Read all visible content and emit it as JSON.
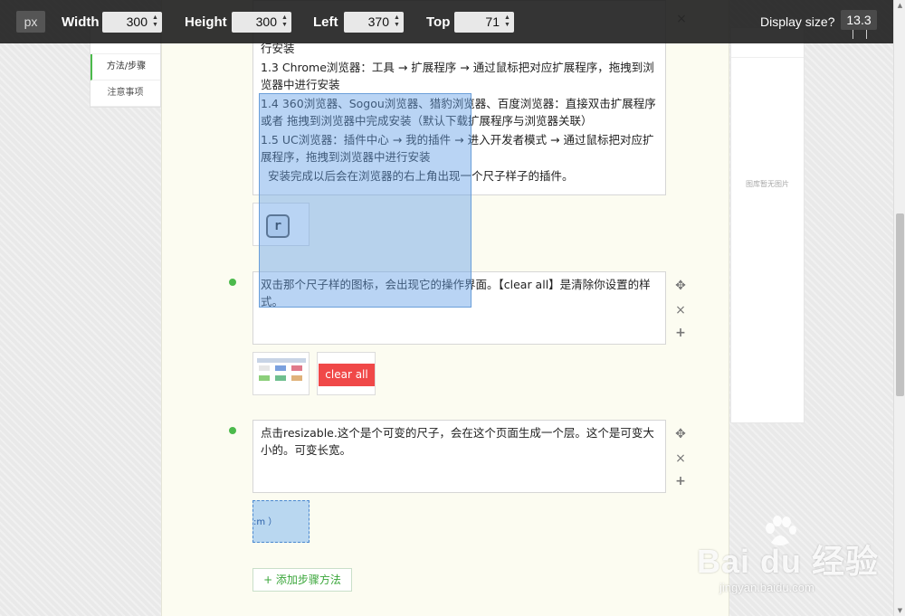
{
  "toolbar": {
    "unit": "px",
    "width_label": "Width",
    "width_value": "300",
    "height_label": "Height",
    "height_value": "300",
    "left_label": "Left",
    "left_value": "370",
    "top_label": "Top",
    "top_value": "71",
    "display_label": "Display size?",
    "display_value": "13.3"
  },
  "left_nav": {
    "items": [
      "方法/步骤",
      "注意事项"
    ]
  },
  "right_panel": {
    "no_image": "图库暂无图片"
  },
  "steps": [
    {
      "paragraphs": [
        "行安装",
        "1.3 Chrome浏览器：工具 → 扩展程序 → 通过鼠标把对应扩展程序，拖拽到浏览器中进行安装",
        "1.4 360浏览器、Sogou浏览器、猎豹浏览器、百度浏览器：直接双击扩展程序 或者 拖拽到浏览器中完成安装（默认下载扩展程序与浏览器关联）",
        "1.5 UC浏览器：插件中心 → 我的插件 → 进入开发者模式 → 通过鼠标把对应扩展程序，拖拽到浏览器中进行安装",
        "  安装完成以后会在浏览器的右上角出现一个尺子样子的插件。"
      ],
      "thumb_icon": "r"
    },
    {
      "paragraphs": [
        "双击那个尺子样的图标，会出现它的操作界面。【clear all】是清除你设置的样式。"
      ],
      "clear_btn": "clear all"
    },
    {
      "paragraphs": [
        "点击resizable.这个是个可变的尺子，会在这个页面生成一个层。这个是可变大小的。可变长宽。"
      ],
      "thumb_text": ":m ）"
    }
  ],
  "add_step": "+ 添加步骤方法",
  "watermark": {
    "logo": "Bai du 经验",
    "url": "jingyan.baidu.com"
  }
}
